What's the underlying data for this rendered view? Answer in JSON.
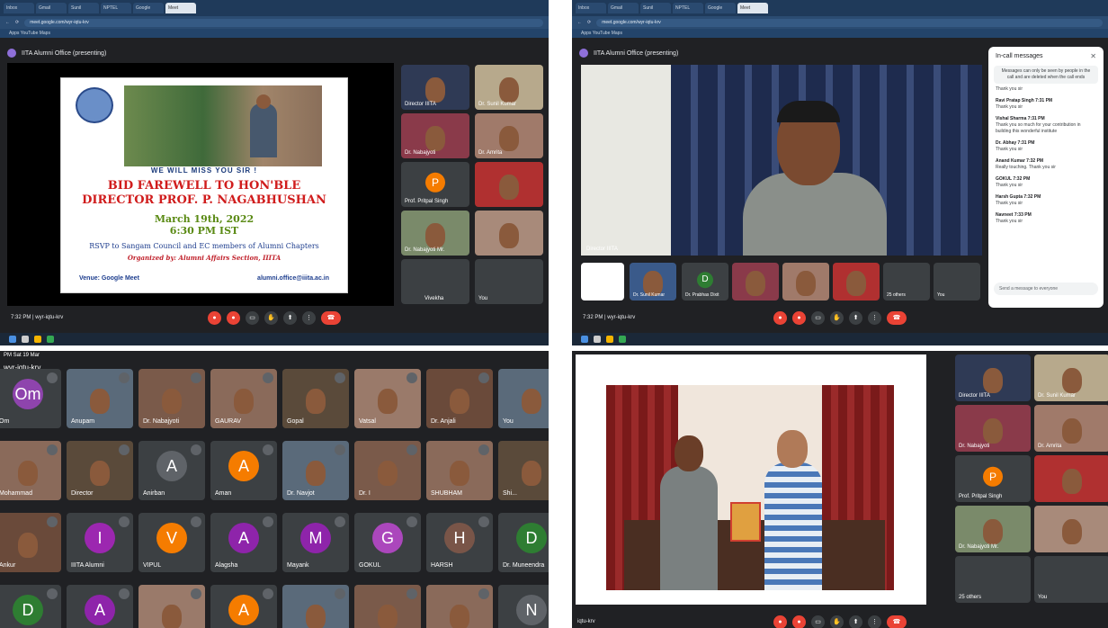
{
  "q1": {
    "tabs": [
      "Inbox",
      "Gmail",
      "Sunil",
      "NPTEL",
      "Meet",
      "Google",
      "Meet"
    ],
    "url": "meet.google.com/wyr-iqtu-krv",
    "bookmarks": "Apps  YouTube  Maps",
    "presenter": "IITA Alumni Office (presenting)",
    "poster": {
      "miss": "WE WILL MISS YOU SIR !",
      "line1": "BID FAREWELL TO HON'BLE",
      "line2": "DIRECTOR PROF. P. NAGABHUSHAN",
      "date": "March 19th, 2022",
      "time": "6:30 PM IST",
      "rsvp": "RSVP to Sangam Council and EC members of Alumni Chapters",
      "org": "Organized by: Alumni Affairs Section, IIITA",
      "venue": "Venue: Google Meet",
      "email": "alumni.office@iiita.ac.in"
    },
    "participants": [
      "Director IIITA",
      "Dr. Sunil Kumar",
      "Dr. Nabajyoti",
      "Dr. Amrita",
      "Prof. Pritpal Singh",
      "",
      "Dr. Nabajyoti Mr.",
      "",
      "Vivekha",
      "You"
    ],
    "avatar_letter": "P",
    "meet_code": "7:32 PM | wyr-iqtu-krv"
  },
  "q2": {
    "presenter": "Director IIITA",
    "chat_title": "In-call messages",
    "chat_notice": "Messages can only be seen by people in the call and are deleted when the call ends",
    "messages": [
      {
        "who": "",
        "text": "Thank you sir"
      },
      {
        "who": "Ravi Pratap Singh 7:31 PM",
        "text": "Thank you sir"
      },
      {
        "who": "Vishal Sharma 7:31 PM",
        "text": "Thank you so much for your contribution in building this wonderful institute"
      },
      {
        "who": "Dr. Abhay 7:31 PM",
        "text": "Thank you sir"
      },
      {
        "who": "Anand Kumar 7:32 PM",
        "text": "Really touching. Thank you sir"
      },
      {
        "who": "GOKUL 7:32 PM",
        "text": "Thank you sir"
      },
      {
        "who": "Harsh Gupta 7:32 PM",
        "text": "Thank you sir"
      },
      {
        "who": "Navneet 7:33 PM",
        "text": "Thank you sir"
      }
    ],
    "send_placeholder": "Send a message to everyone",
    "strip": [
      "",
      "Dr. Sunil Kumar",
      "Dr. Prabhas Dixit",
      "",
      "",
      "",
      "25 others",
      "You"
    ],
    "meet_code": "7:32 PM | wyr-iqtu-krv"
  },
  "q3": {
    "header": "wyr-iqtu-krv",
    "time": "PM  Sat 19 Mar",
    "row1": [
      {
        "name": "Om",
        "letter": "Om",
        "color": "#8e44ad"
      },
      {
        "name": "Anupam",
        "letter": "",
        "color": ""
      },
      {
        "name": "Dr. Nabajyoti",
        "letter": "",
        "color": ""
      },
      {
        "name": "GAURAV",
        "letter": "",
        "color": ""
      },
      {
        "name": "Gopal",
        "letter": "",
        "color": ""
      },
      {
        "name": "Vatsal",
        "letter": "",
        "color": ""
      },
      {
        "name": "Dr. Anjali",
        "letter": "",
        "color": ""
      },
      {
        "name": "You",
        "letter": "",
        "color": ""
      }
    ],
    "row2": [
      {
        "name": "Mohammad",
        "letter": "",
        "color": ""
      },
      {
        "name": "Director",
        "letter": "",
        "color": ""
      },
      {
        "name": "Anirban",
        "letter": "A",
        "color": "#5f6368"
      },
      {
        "name": "Aman",
        "letter": "A",
        "color": "#f57c00"
      },
      {
        "name": "Dr. Navjot",
        "letter": "",
        "color": ""
      },
      {
        "name": "Dr. I",
        "letter": "",
        "color": ""
      },
      {
        "name": "SHUBHAM",
        "letter": "",
        "color": ""
      },
      {
        "name": "Shi...",
        "letter": "",
        "color": ""
      }
    ],
    "row3": [
      {
        "name": "Ankur",
        "letter": "",
        "color": ""
      },
      {
        "name": "IIITA Alumni",
        "letter": "I",
        "color": "#9c27b0"
      },
      {
        "name": "VIPUL",
        "letter": "V",
        "color": "#f57c00"
      },
      {
        "name": "Alagsha",
        "letter": "A",
        "color": "#8e24aa"
      },
      {
        "name": "Mayank",
        "letter": "M",
        "color": "#8e24aa"
      },
      {
        "name": "GOKUL",
        "letter": "G",
        "color": "#ab47bc"
      },
      {
        "name": "HARSH",
        "letter": "H",
        "color": "#795548"
      },
      {
        "name": "Dr. Muneendra",
        "letter": "D",
        "color": "#2e7d32"
      }
    ],
    "row4": [
      {
        "name": "",
        "letter": "D",
        "color": "#2e7d32"
      },
      {
        "name": "",
        "letter": "A",
        "color": "#8e24aa"
      },
      {
        "name": "",
        "letter": "",
        "color": ""
      },
      {
        "name": "",
        "letter": "A",
        "color": "#f57c00"
      },
      {
        "name": "",
        "letter": "",
        "color": ""
      },
      {
        "name": "",
        "letter": "",
        "color": ""
      },
      {
        "name": "",
        "letter": "",
        "color": ""
      },
      {
        "name": "",
        "letter": "N",
        "color": "#5f6368"
      }
    ]
  },
  "q4": {
    "participants": [
      "Director IIITA",
      "Dr. Sunil Kumar",
      "Dr. Nabajyoti",
      "Dr. Amrita",
      "Prof. Pritpal Singh",
      "",
      "Dr. Nabajyoti Mr.",
      "",
      "25 others",
      "You"
    ],
    "avatar_letter": "P",
    "meet_code": "iqtu-krv"
  }
}
